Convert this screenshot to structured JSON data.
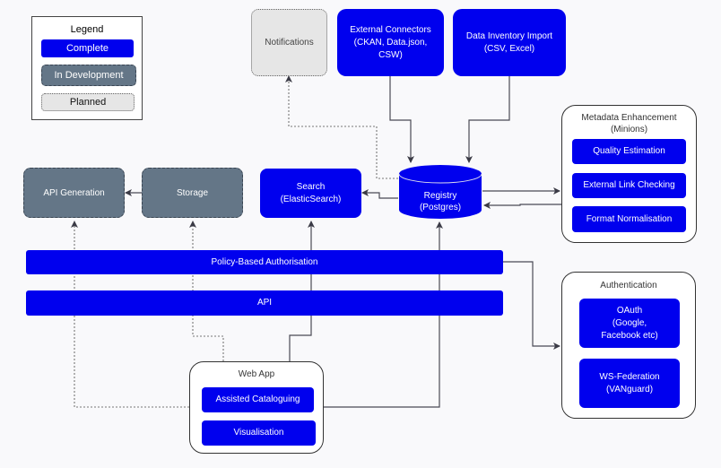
{
  "legend": {
    "title": "Legend",
    "complete": "Complete",
    "in_development": "In Development",
    "planned": "Planned"
  },
  "colors": {
    "complete": "#0000ee",
    "in_development": "#647687",
    "planned": "#e6e6e6",
    "connector": "#4a4a55"
  },
  "nodes": {
    "notifications": "Notifications",
    "external_connectors": "External Connectors\n(CKAN, Data.json,\nCSW)",
    "data_inventory_import": "Data Inventory Import\n(CSV, Excel)",
    "registry": "Registry\n(Postgres)",
    "search": "Search\n(ElasticSearch)",
    "storage": "Storage",
    "api_generation": "API Generation",
    "policy_auth": "Policy-Based Authorisation",
    "api": "API"
  },
  "metadata_group": {
    "title": "Metadata Enhancement\n(Minions)",
    "items": [
      "Quality Estimation",
      "External Link Checking",
      "Format Normalisation"
    ]
  },
  "auth_group": {
    "title": "Authentication",
    "items": [
      "OAuth\n(Google,\nFacebook etc)",
      "WS-Federation\n(VANguard)"
    ]
  },
  "webapp_group": {
    "title": "Web App",
    "items": [
      "Assisted Cataloguing",
      "Visualisation"
    ]
  }
}
